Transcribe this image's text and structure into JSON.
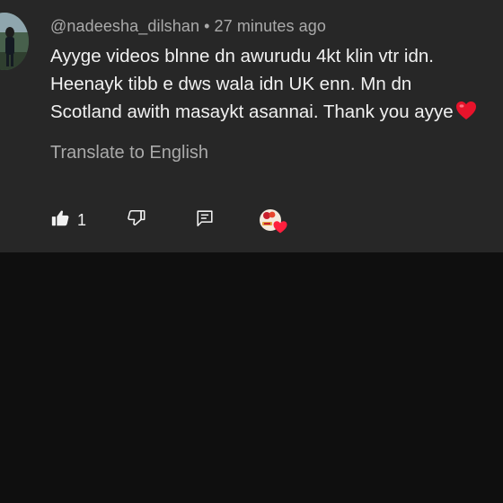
{
  "comment": {
    "author": "@nadeesha_dilshan",
    "separator": "•",
    "timestamp": "27 minutes ago",
    "text_lines": [
      "Ayyge videos blnne dn awurudu 4kt klin vtr idn.",
      "Heenayk tibb e dws wala idn UK enn. Mn dn",
      "Scotland awith masaykt asannai. Thank you ayye"
    ],
    "translate_label": "Translate to English",
    "like_count": "1"
  },
  "icons": {
    "avatar": "profile-avatar",
    "like": "thumbs-up-icon",
    "dislike": "thumbs-down-icon",
    "reply": "reply-comment-icon",
    "creator_heart": "creator-heart-badge",
    "emoji": "red-heart-emoji"
  },
  "colors": {
    "card_background": "#272727",
    "page_background": "#0f0f0f",
    "primary_text": "#f1f1f1",
    "secondary_text": "#aaaaaa",
    "heart_red": "#e8132b"
  }
}
